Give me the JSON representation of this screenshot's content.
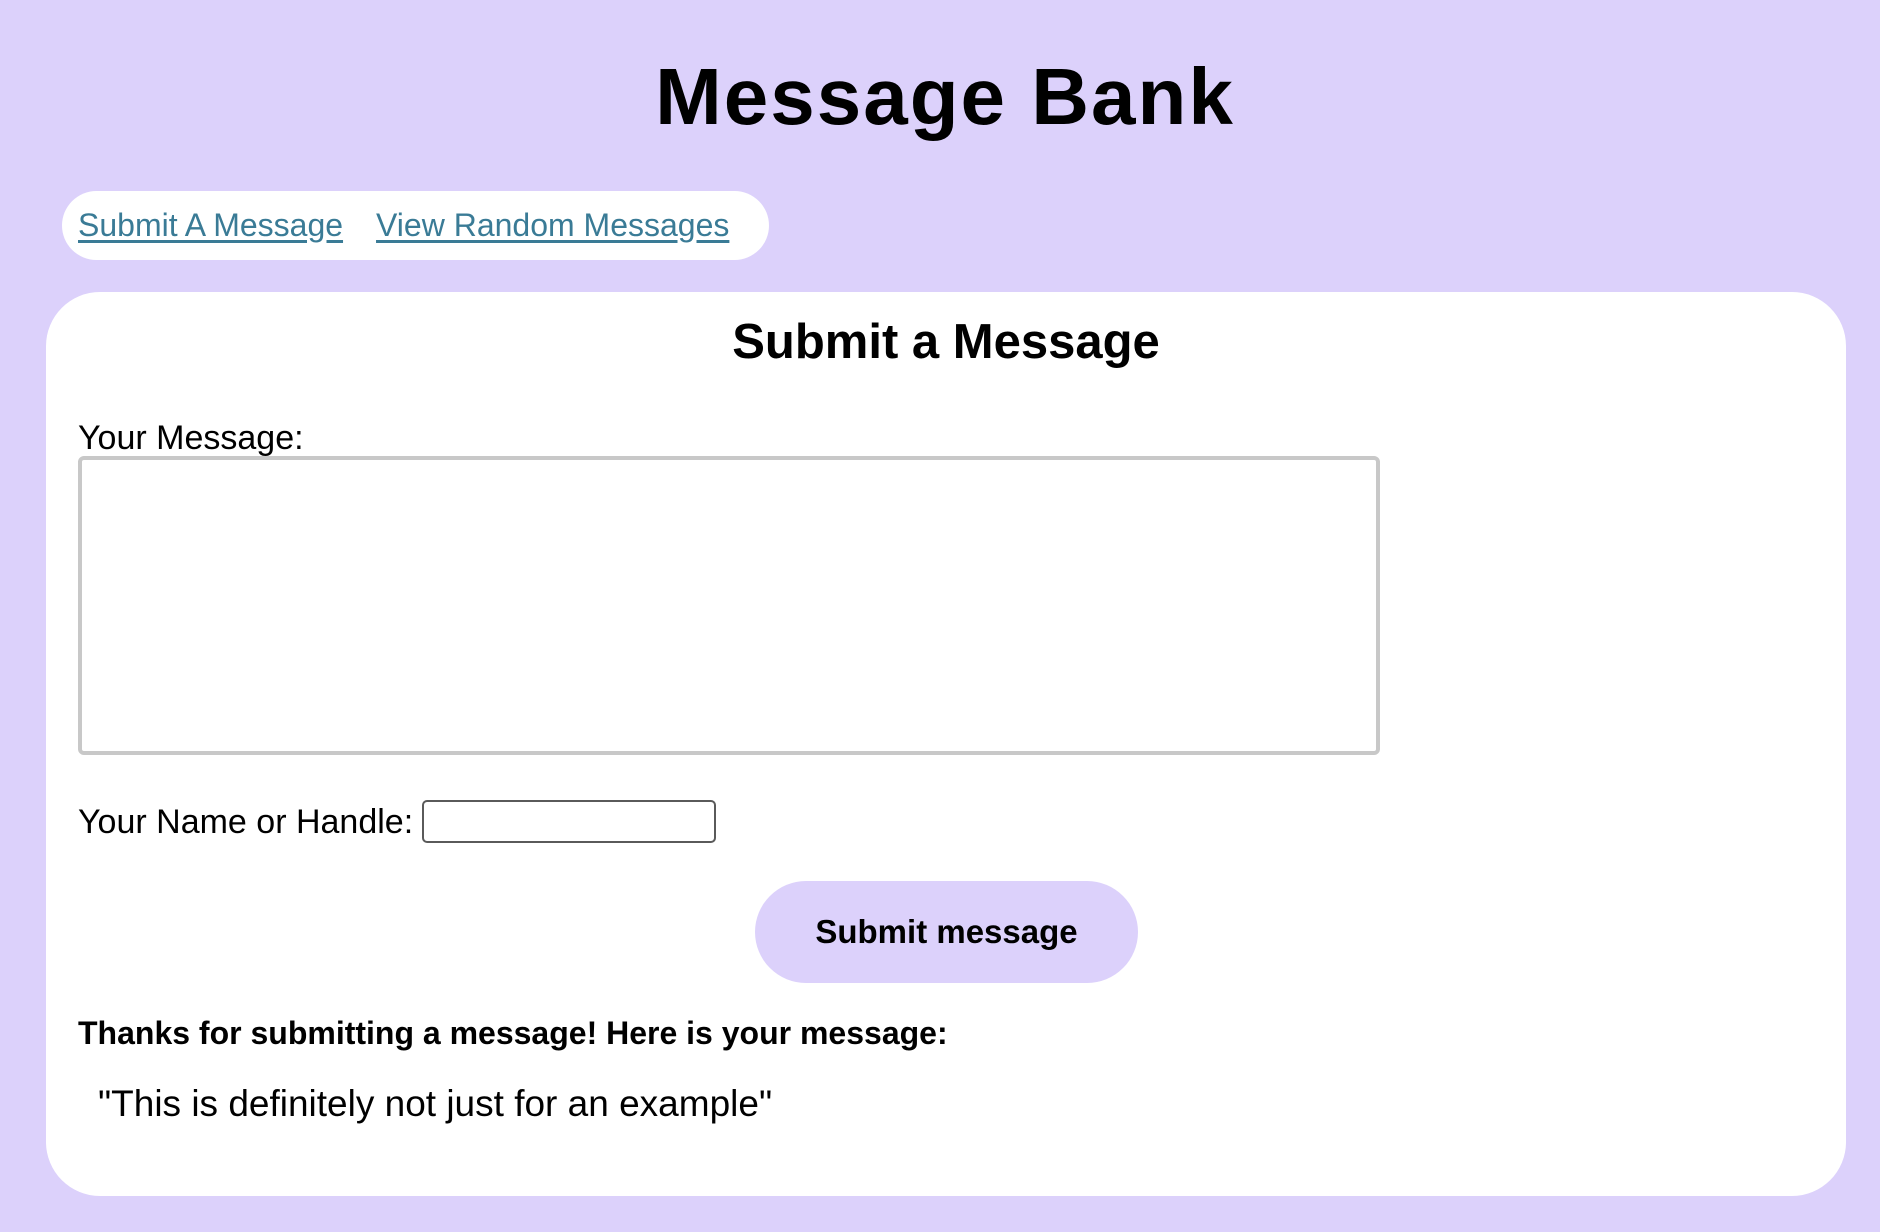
{
  "site": {
    "title": "Message Bank"
  },
  "nav": {
    "items": [
      {
        "label": "Submit A Message"
      },
      {
        "label": "View Random Messages"
      }
    ]
  },
  "form": {
    "heading": "Submit a Message",
    "message_label": "Your Message:",
    "message_value": "",
    "name_label": "Your Name or Handle:",
    "name_value": "",
    "submit_label": "Submit message"
  },
  "result": {
    "thanks_text": "Thanks for submitting a message! Here is your message:",
    "submitted_message": "\"This is definitely not just for an example\""
  },
  "colors": {
    "page_background": "#dcd1fb",
    "panel_background": "#ffffff",
    "link": "#3a7b96",
    "button_background": "#dcd1fb"
  }
}
